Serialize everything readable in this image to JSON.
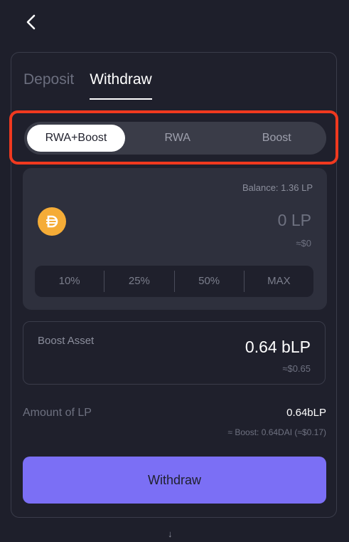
{
  "nav": {
    "back_icon": "chevron-left-icon"
  },
  "tabs": [
    {
      "label": "Deposit",
      "active": false
    },
    {
      "label": "Withdraw",
      "active": true
    }
  ],
  "segments": [
    {
      "label": "RWA+Boost",
      "active": true
    },
    {
      "label": "RWA",
      "active": false
    },
    {
      "label": "Boost",
      "active": false
    }
  ],
  "input": {
    "balance_label": "Balance:",
    "balance_value": "1.36 LP",
    "token_icon": "dai-coin-icon",
    "amount": "0 LP",
    "usd": "≈$0",
    "percent_options": [
      "10%",
      "25%",
      "50%",
      "MAX"
    ]
  },
  "boost_asset": {
    "label": "Boost Asset",
    "value": "0.64 bLP",
    "usd": "≈$0.65"
  },
  "amount_of_lp": {
    "label": "Amount of LP",
    "value": "0.64bLP",
    "detail": "≈ Boost: 0.64DAI (≈$0.17)"
  },
  "withdraw_button": "Withdraw",
  "footer_arrow": "↓",
  "colors": {
    "background": "#1e1f2b",
    "panel": "#2e303d",
    "accent": "#7b6ff5",
    "highlight": "#f0391f",
    "coin": "#f5ac37"
  }
}
